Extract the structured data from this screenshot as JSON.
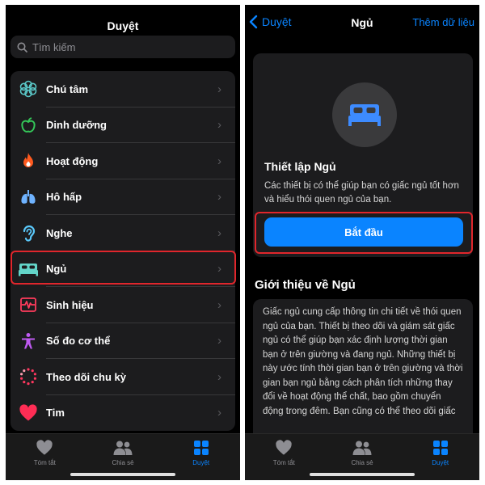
{
  "left": {
    "title": "Duyệt",
    "search_placeholder": "Tìm kiếm",
    "categories": [
      {
        "label": "Chú tâm",
        "icon": "mindfulness-icon"
      },
      {
        "label": "Dinh dưỡng",
        "icon": "nutrition-apple-icon"
      },
      {
        "label": "Hoạt động",
        "icon": "activity-flame-icon"
      },
      {
        "label": "Hô hấp",
        "icon": "respiratory-lungs-icon"
      },
      {
        "label": "Nghe",
        "icon": "hearing-ear-icon"
      },
      {
        "label": "Ngủ",
        "icon": "sleep-bed-icon"
      },
      {
        "label": "Sinh hiệu",
        "icon": "vitals-icon"
      },
      {
        "label": "Số đo cơ thể",
        "icon": "body-measurements-icon"
      },
      {
        "label": "Theo dõi chu kỳ",
        "icon": "cycle-tracking-icon"
      },
      {
        "label": "Tim",
        "icon": "heart-icon"
      }
    ]
  },
  "tabs": [
    {
      "label": "Tóm tắt",
      "icon": "heart-icon"
    },
    {
      "label": "Chia sẻ",
      "icon": "people-icon"
    },
    {
      "label": "Duyệt",
      "icon": "grid-icon"
    }
  ],
  "right": {
    "back_label": "Duyệt",
    "title": "Ngủ",
    "add_data_label": "Thêm dữ liệu",
    "setup_title": "Thiết lập Ngủ",
    "setup_desc": "Các thiết bị có thể giúp bạn có giấc ngủ tốt hơn và hiểu thói quen ngủ của bạn.",
    "start_label": "Bắt đầu",
    "about_title": "Giới thiệu về Ngủ",
    "about_text": "Giấc ngủ cung cấp thông tin chi tiết về thói quen ngủ của bạn. Thiết bị theo dõi và giám sát giấc ngủ có thể giúp bạn xác định lượng thời gian bạn ở trên giường và đang ngủ. Những thiết bị này ước tính thời gian bạn ở trên giường và thời gian bạn ngủ bằng cách phân tích những thay đổi về hoạt động thể chất, bao gồm chuyển động trong đêm. Bạn cũng có thể theo dõi giấc"
  },
  "colors": {
    "accent": "#0a84ff",
    "highlight": "#e0262c",
    "background": "#000000",
    "card": "#1c1c1e"
  }
}
